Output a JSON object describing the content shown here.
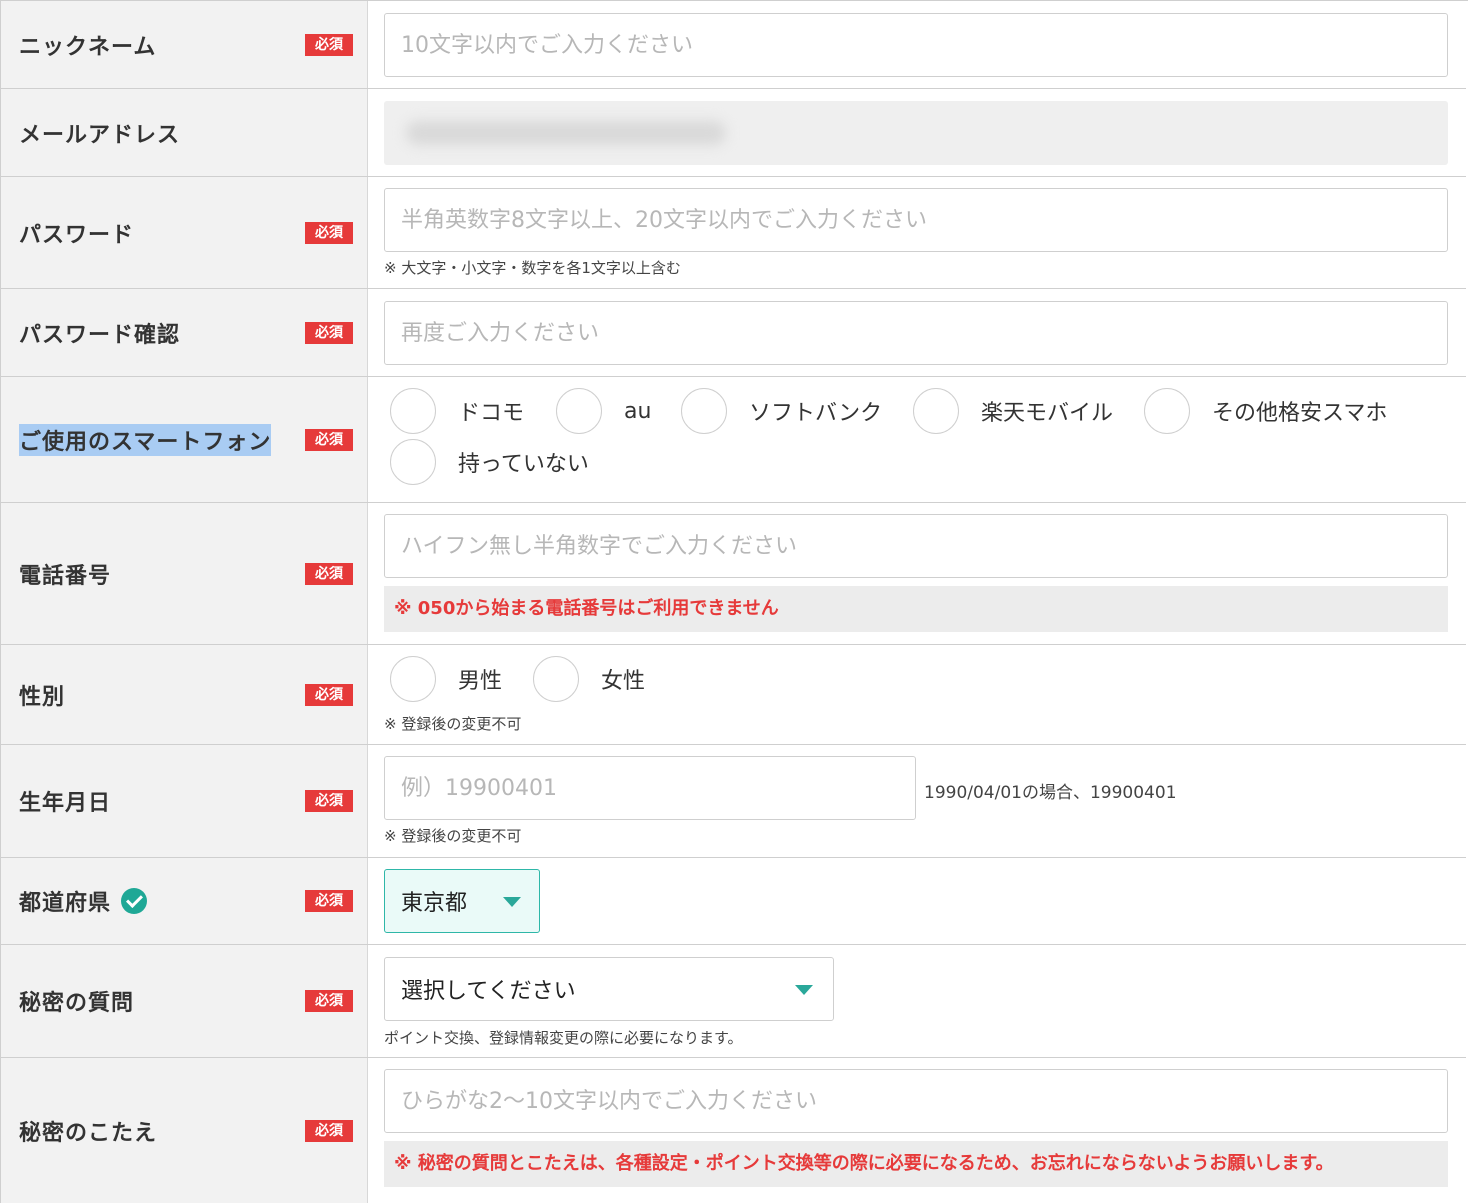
{
  "required_badge": "必須",
  "nickname": {
    "label": "ニックネーム",
    "placeholder": "10文字以内でご入力ください"
  },
  "email": {
    "label": "メールアドレス"
  },
  "password": {
    "label": "パスワード",
    "placeholder": "半角英数字8文字以上、20文字以内でご入力ください",
    "note": "※ 大文字・小文字・数字を各1文字以上含む"
  },
  "password_confirm": {
    "label": "パスワード確認",
    "placeholder": "再度ご入力ください"
  },
  "smartphone": {
    "label": "ご使用のスマートフォン",
    "options": [
      "ドコモ",
      "au",
      "ソフトバンク",
      "楽天モバイル",
      "その他格安スマホ",
      "持っていない"
    ]
  },
  "phone": {
    "label": "電話番号",
    "placeholder": "ハイフン無し半角数字でご入力ください",
    "alert": "※ 050から始まる電話番号はご利用できません"
  },
  "gender": {
    "label": "性別",
    "options": [
      "男性",
      "女性"
    ],
    "note": "※ 登録後の変更不可"
  },
  "birthday": {
    "label": "生年月日",
    "placeholder": "例）19900401",
    "hint": "1990/04/01の場合、19900401",
    "note": "※ 登録後の変更不可"
  },
  "prefecture": {
    "label": "都道府県",
    "value": "東京都",
    "icon": "check-circle-icon"
  },
  "secret_question": {
    "label": "秘密の質問",
    "value": "選択してください",
    "note": "ポイント交換、登録情報変更の際に必要になります。"
  },
  "secret_answer": {
    "label": "秘密のこたえ",
    "placeholder": "ひらがな2〜10文字以内でご入力ください",
    "alert": "※ 秘密の質問とこたえは、各種設定・ポイント交換等の際に必要になるため、お忘れにならないようお願いします。"
  },
  "colors": {
    "required": "#e63a3a",
    "accent": "#2aa89a",
    "label_bg": "#f2f2f2",
    "highlight": "#a9ccf3"
  }
}
